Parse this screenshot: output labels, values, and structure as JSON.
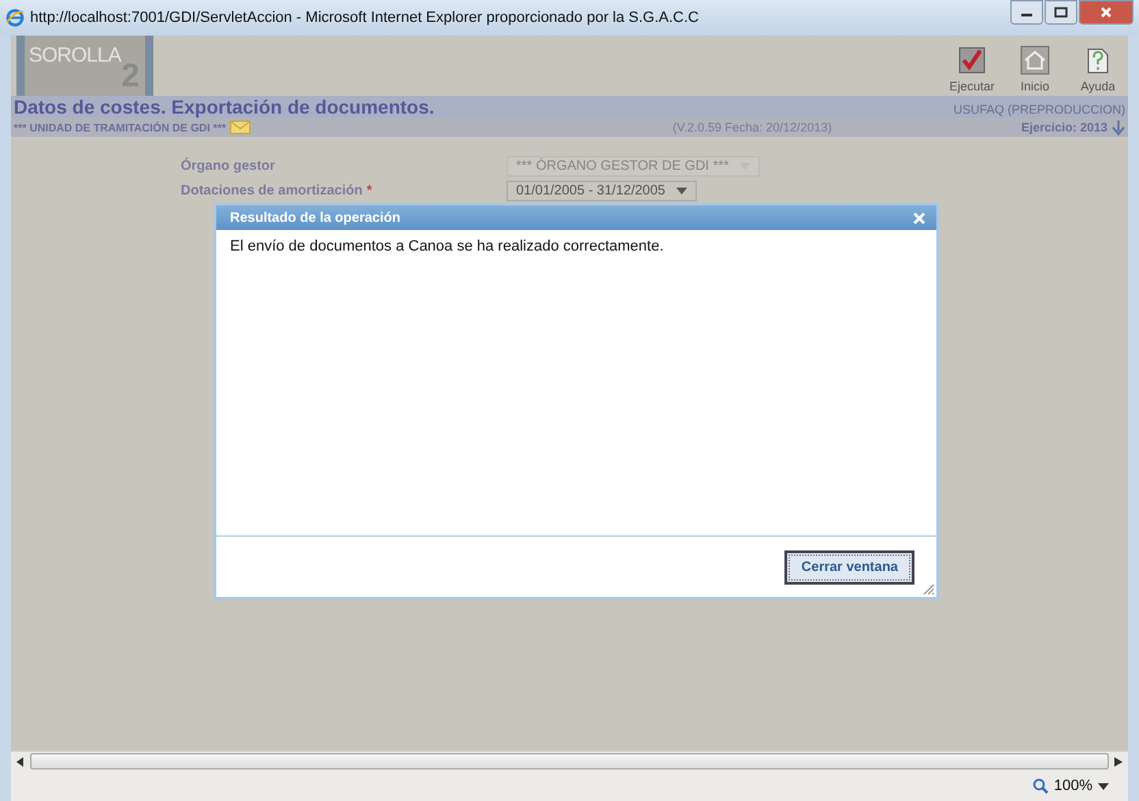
{
  "window": {
    "title": "http://localhost:7001/GDI/ServletAccion - Microsoft Internet Explorer proporcionado por la S.G.A.C.C"
  },
  "app": {
    "logo": "SOROLLA",
    "logo_mark": "2"
  },
  "toolbar": [
    {
      "label": "Ejecutar",
      "kind": "run"
    },
    {
      "label": "Inicio",
      "kind": "home"
    },
    {
      "label": "Ayuda",
      "kind": "help"
    }
  ],
  "header": {
    "title": "Datos de costes. Exportación de documentos.",
    "user": "USUFAQ (PREPRODUCCION)",
    "unit": "*** UNIDAD DE TRAMITACIÓN DE GDI ***",
    "version": "(V.2.0.59 Fecha: 20/12/2013)",
    "year": "Ejercicio: 2013"
  },
  "form": [
    {
      "label": "Órgano gestor",
      "value": "*** ÓRGANO GESTOR DE GDI ***",
      "disabled": true
    },
    {
      "label": "Dotaciones de amortización",
      "required_mark": "*",
      "value": "01/01/2005 - 31/12/2005",
      "disabled": false
    }
  ],
  "dialog": {
    "title": "Resultado de la operación",
    "message": "El envío de documentos a Canoa se ha realizado correctamente.",
    "button": "Cerrar ventana"
  },
  "status_bar": {
    "zoom": "100%"
  }
}
